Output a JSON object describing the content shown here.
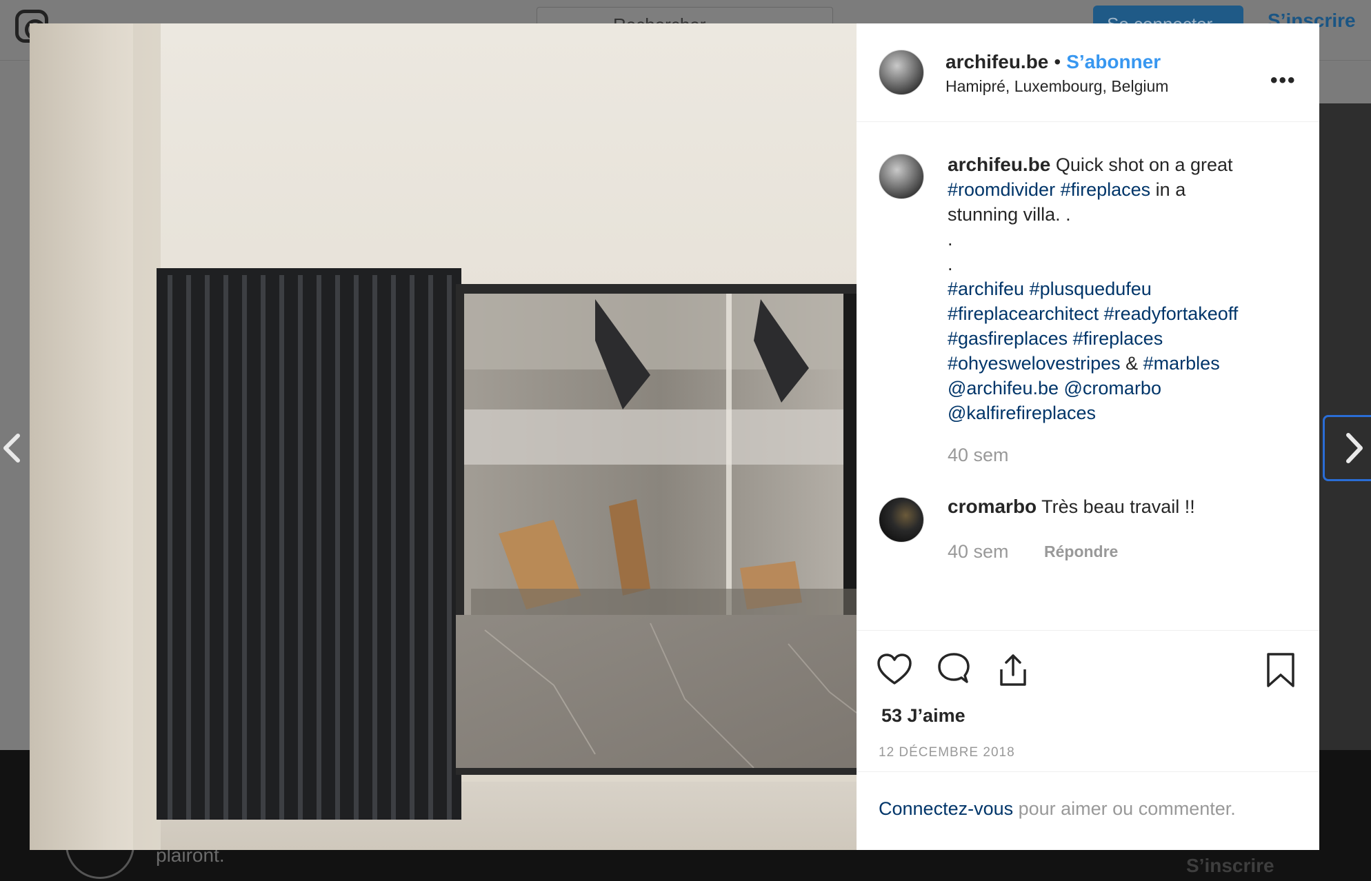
{
  "background": {
    "search_placeholder": "Rechercher",
    "login_button": "Se connecter",
    "signup_link": "S’inscrire",
    "footer_text": "plairont.",
    "footer_signup": "S’inscrire"
  },
  "post": {
    "username": "archifeu.be",
    "follow_label": "S’abonner",
    "location": "Hamipré, Luxembourg, Belgium",
    "more_label": "•••",
    "caption_lines": [
      [
        {
          "t": "Quick shot on a great",
          "k": "text"
        }
      ],
      [
        {
          "t": "#roomdivider",
          "k": "tag"
        },
        {
          "t": " ",
          "k": "text"
        },
        {
          "t": "#fireplaces",
          "k": "tag"
        },
        {
          "t": " in a",
          "k": "text"
        }
      ],
      [
        {
          "t": "stunning villa. .",
          "k": "text"
        }
      ],
      [
        {
          "t": ".",
          "k": "text"
        }
      ],
      [
        {
          "t": ".",
          "k": "text"
        }
      ],
      [
        {
          "t": "#archifeu",
          "k": "tag"
        },
        {
          "t": " ",
          "k": "text"
        },
        {
          "t": "#plusquedufeu",
          "k": "tag"
        }
      ],
      [
        {
          "t": "#fireplacearchitect",
          "k": "tag"
        },
        {
          "t": " ",
          "k": "text"
        },
        {
          "t": "#readyfortakeoff",
          "k": "tag"
        }
      ],
      [
        {
          "t": "#gasfireplaces",
          "k": "tag"
        },
        {
          "t": " ",
          "k": "text"
        },
        {
          "t": "#fireplaces",
          "k": "tag"
        }
      ],
      [
        {
          "t": "#ohyeswelovestripes",
          "k": "tag"
        },
        {
          "t": " & ",
          "k": "text"
        },
        {
          "t": "#marbles",
          "k": "tag"
        }
      ],
      [
        {
          "t": "@archifeu.be",
          "k": "tag"
        },
        {
          "t": " ",
          "k": "text"
        },
        {
          "t": "@cromarbo",
          "k": "tag"
        }
      ],
      [
        {
          "t": "@kalfirefireplaces",
          "k": "tag"
        }
      ]
    ],
    "caption_time": "40 sem",
    "comment": {
      "username": "cromarbo",
      "text": "Très beau travail !!",
      "time": "40 sem",
      "reply_label": "Répondre"
    },
    "likes": "53 J’aime",
    "date": "12 DÉCEMBRE 2018",
    "login_prompt": {
      "link": "Connectez-vous",
      "text": " pour aimer ou commenter."
    }
  },
  "icons": [
    "heart-icon",
    "comment-icon",
    "share-icon",
    "bookmark-icon",
    "chevron-left-icon",
    "chevron-right-icon",
    "instagram-logo-icon"
  ]
}
